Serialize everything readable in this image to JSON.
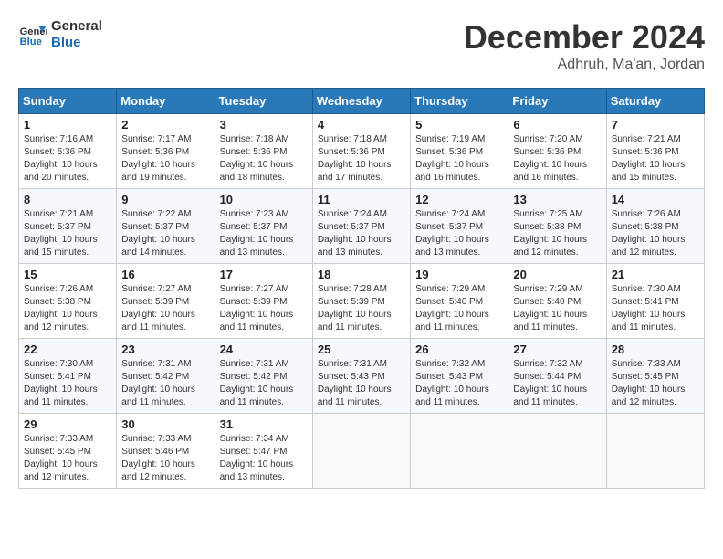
{
  "header": {
    "logo_line1": "General",
    "logo_line2": "Blue",
    "month_title": "December 2024",
    "location": "Adhruh, Ma'an, Jordan"
  },
  "days_of_week": [
    "Sunday",
    "Monday",
    "Tuesday",
    "Wednesday",
    "Thursday",
    "Friday",
    "Saturday"
  ],
  "weeks": [
    [
      {
        "day": "1",
        "sunrise": "7:16 AM",
        "sunset": "5:36 PM",
        "daylight": "10 hours and 20 minutes."
      },
      {
        "day": "2",
        "sunrise": "7:17 AM",
        "sunset": "5:36 PM",
        "daylight": "10 hours and 19 minutes."
      },
      {
        "day": "3",
        "sunrise": "7:18 AM",
        "sunset": "5:36 PM",
        "daylight": "10 hours and 18 minutes."
      },
      {
        "day": "4",
        "sunrise": "7:18 AM",
        "sunset": "5:36 PM",
        "daylight": "10 hours and 17 minutes."
      },
      {
        "day": "5",
        "sunrise": "7:19 AM",
        "sunset": "5:36 PM",
        "daylight": "10 hours and 16 minutes."
      },
      {
        "day": "6",
        "sunrise": "7:20 AM",
        "sunset": "5:36 PM",
        "daylight": "10 hours and 16 minutes."
      },
      {
        "day": "7",
        "sunrise": "7:21 AM",
        "sunset": "5:36 PM",
        "daylight": "10 hours and 15 minutes."
      }
    ],
    [
      {
        "day": "8",
        "sunrise": "7:21 AM",
        "sunset": "5:37 PM",
        "daylight": "10 hours and 15 minutes."
      },
      {
        "day": "9",
        "sunrise": "7:22 AM",
        "sunset": "5:37 PM",
        "daylight": "10 hours and 14 minutes."
      },
      {
        "day": "10",
        "sunrise": "7:23 AM",
        "sunset": "5:37 PM",
        "daylight": "10 hours and 13 minutes."
      },
      {
        "day": "11",
        "sunrise": "7:24 AM",
        "sunset": "5:37 PM",
        "daylight": "10 hours and 13 minutes."
      },
      {
        "day": "12",
        "sunrise": "7:24 AM",
        "sunset": "5:37 PM",
        "daylight": "10 hours and 13 minutes."
      },
      {
        "day": "13",
        "sunrise": "7:25 AM",
        "sunset": "5:38 PM",
        "daylight": "10 hours and 12 minutes."
      },
      {
        "day": "14",
        "sunrise": "7:26 AM",
        "sunset": "5:38 PM",
        "daylight": "10 hours and 12 minutes."
      }
    ],
    [
      {
        "day": "15",
        "sunrise": "7:26 AM",
        "sunset": "5:38 PM",
        "daylight": "10 hours and 12 minutes."
      },
      {
        "day": "16",
        "sunrise": "7:27 AM",
        "sunset": "5:39 PM",
        "daylight": "10 hours and 11 minutes."
      },
      {
        "day": "17",
        "sunrise": "7:27 AM",
        "sunset": "5:39 PM",
        "daylight": "10 hours and 11 minutes."
      },
      {
        "day": "18",
        "sunrise": "7:28 AM",
        "sunset": "5:39 PM",
        "daylight": "10 hours and 11 minutes."
      },
      {
        "day": "19",
        "sunrise": "7:29 AM",
        "sunset": "5:40 PM",
        "daylight": "10 hours and 11 minutes."
      },
      {
        "day": "20",
        "sunrise": "7:29 AM",
        "sunset": "5:40 PM",
        "daylight": "10 hours and 11 minutes."
      },
      {
        "day": "21",
        "sunrise": "7:30 AM",
        "sunset": "5:41 PM",
        "daylight": "10 hours and 11 minutes."
      }
    ],
    [
      {
        "day": "22",
        "sunrise": "7:30 AM",
        "sunset": "5:41 PM",
        "daylight": "10 hours and 11 minutes."
      },
      {
        "day": "23",
        "sunrise": "7:31 AM",
        "sunset": "5:42 PM",
        "daylight": "10 hours and 11 minutes."
      },
      {
        "day": "24",
        "sunrise": "7:31 AM",
        "sunset": "5:42 PM",
        "daylight": "10 hours and 11 minutes."
      },
      {
        "day": "25",
        "sunrise": "7:31 AM",
        "sunset": "5:43 PM",
        "daylight": "10 hours and 11 minutes."
      },
      {
        "day": "26",
        "sunrise": "7:32 AM",
        "sunset": "5:43 PM",
        "daylight": "10 hours and 11 minutes."
      },
      {
        "day": "27",
        "sunrise": "7:32 AM",
        "sunset": "5:44 PM",
        "daylight": "10 hours and 11 minutes."
      },
      {
        "day": "28",
        "sunrise": "7:33 AM",
        "sunset": "5:45 PM",
        "daylight": "10 hours and 12 minutes."
      }
    ],
    [
      {
        "day": "29",
        "sunrise": "7:33 AM",
        "sunset": "5:45 PM",
        "daylight": "10 hours and 12 minutes."
      },
      {
        "day": "30",
        "sunrise": "7:33 AM",
        "sunset": "5:46 PM",
        "daylight": "10 hours and 12 minutes."
      },
      {
        "day": "31",
        "sunrise": "7:34 AM",
        "sunset": "5:47 PM",
        "daylight": "10 hours and 13 minutes."
      },
      null,
      null,
      null,
      null
    ]
  ],
  "labels": {
    "sunrise": "Sunrise:",
    "sunset": "Sunset:",
    "daylight": "Daylight:"
  }
}
